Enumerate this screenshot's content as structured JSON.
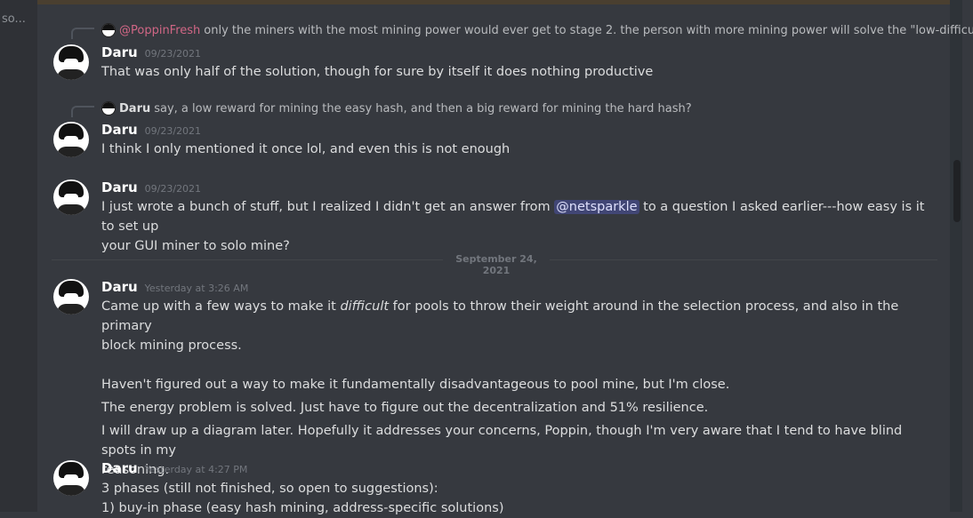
{
  "sidebar": {
    "truncated_label": "so..."
  },
  "messages": [
    {
      "reply": {
        "mention": "@PoppinFresh",
        "text": "only the miners with the most mining power would ever get to stage 2. the person with more mining power will solve the \"low-difficulty ..."
      },
      "author": "Daru",
      "time": "09/23/2021",
      "text": "That was only half of the solution, though for sure by itself it does nothing productive"
    },
    {
      "reply": {
        "author": "Daru",
        "text": "say, a low reward for mining the easy hash, and then a big reward for mining the hard hash?"
      },
      "author": "Daru",
      "time": "09/23/2021",
      "text": "I think I only mentioned it once lol, and even this is not enough"
    },
    {
      "author": "Daru",
      "time": "09/23/2021",
      "text_before": "I just wrote a bunch of stuff, but I realized I didn't get an answer from",
      "mention": "@netsparkle",
      "text_after": "to a question I asked earlier---how easy is it to set up",
      "text_line2": "your GUI miner to solo mine?"
    },
    {
      "author": "Daru",
      "time": "Yesterday at 3:26 AM",
      "line1_before": "Came up with a few ways to make it",
      "line1_em": "difficult",
      "line1_after": "for pools to throw their weight around in the selection process, and also in the primary",
      "line2": "block mining process.",
      "line3": "Haven't figured out a way to make it fundamentally disadvantageous to pool mine, but I'm close.",
      "line4": "The energy problem is solved. Just have to figure out the decentralization and 51% resilience.",
      "line5": "I will draw up a diagram later. Hopefully it addresses your concerns, Poppin, though I'm very aware that I tend to have blind spots in my",
      "line6": "reasoning."
    },
    {
      "author": "Daru",
      "time": "Yesterday at 4:27 PM",
      "line1": "3 phases (still not finished, so open to suggestions):",
      "line2": "1) buy-in phase (easy hash mining, address-specific solutions)"
    }
  ],
  "divider": {
    "label": "September 24, 2021"
  }
}
